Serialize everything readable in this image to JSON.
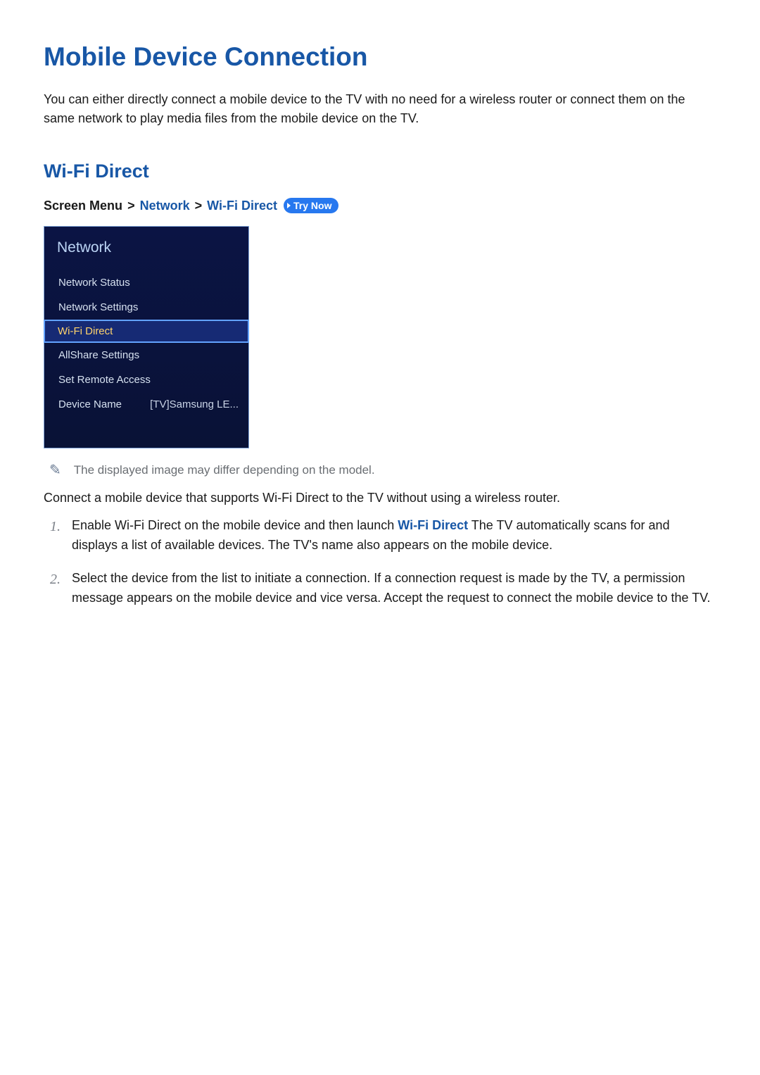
{
  "page": {
    "title": "Mobile Device Connection",
    "intro": "You can either directly connect a mobile device to the TV with no need for a wireless router or connect them on the same network to play media files from the mobile device on the TV."
  },
  "section": {
    "title": "Wi-Fi Direct"
  },
  "breadcrumb": {
    "root": "Screen Menu",
    "level1": "Network",
    "level2": "Wi-Fi Direct",
    "trynow": "Try Now"
  },
  "menu": {
    "header": "Network",
    "items": [
      {
        "label": "Network Status",
        "selected": false
      },
      {
        "label": "Network Settings",
        "selected": false
      },
      {
        "label": "Wi-Fi Direct",
        "selected": true
      },
      {
        "label": "AllShare Settings",
        "selected": false
      },
      {
        "label": "Set Remote Access",
        "selected": false
      },
      {
        "label": "Device Name",
        "value": "[TV]Samsung LE...",
        "selected": false
      }
    ]
  },
  "note": {
    "text": "The displayed image may differ depending on the model."
  },
  "body": {
    "lead": "Connect a mobile device that supports Wi-Fi Direct to the TV without using a wireless router.",
    "steps": [
      {
        "num": "1.",
        "pre": "Enable Wi-Fi Direct on the mobile device and then launch ",
        "em": "Wi-Fi Direct",
        "post": " The TV automatically scans for and displays a list of available devices. The TV's name also appears on the mobile device."
      },
      {
        "num": "2.",
        "pre": "Select the device from the list to initiate a connection. If a connection request is made by the TV, a permission message appears on the mobile device and vice versa. Accept the request to connect the mobile device to the TV.",
        "em": "",
        "post": ""
      }
    ]
  }
}
